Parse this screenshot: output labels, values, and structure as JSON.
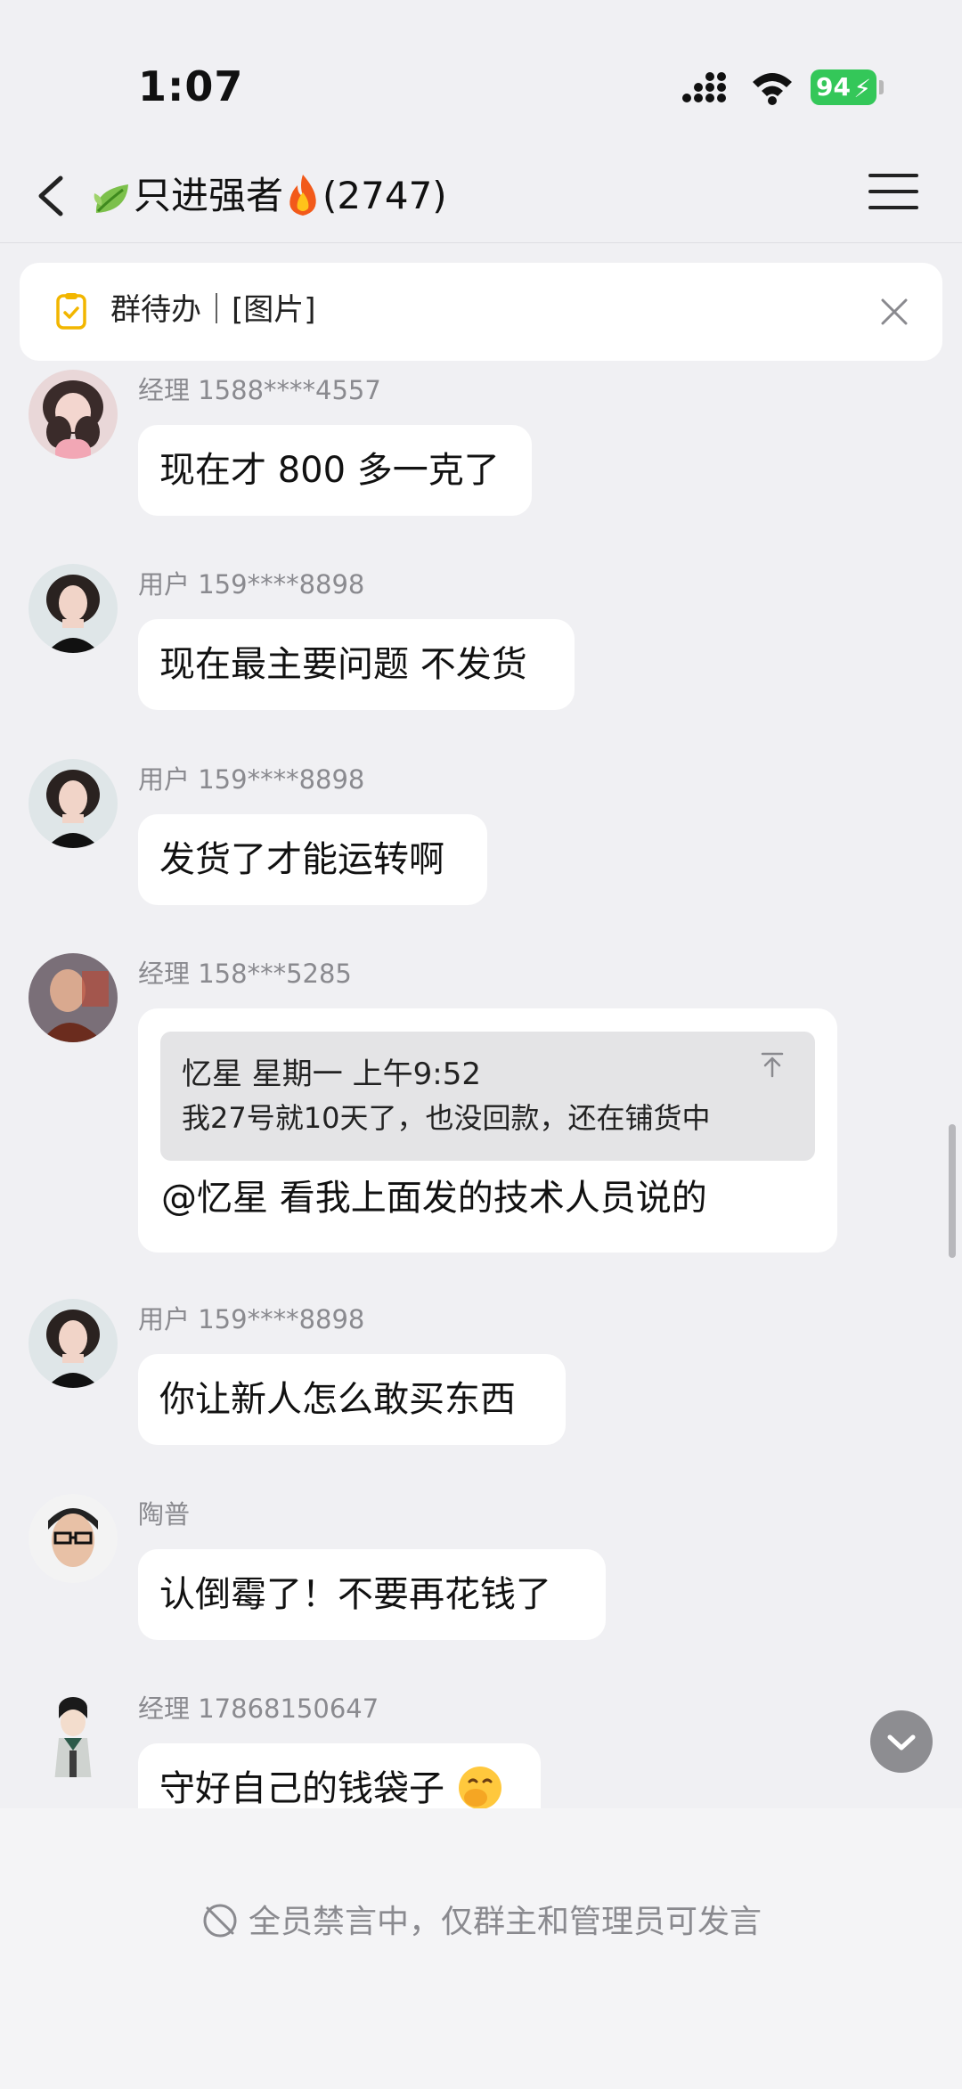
{
  "status_bar": {
    "time": "1:07",
    "battery": "94"
  },
  "header": {
    "group_name": "只进强者",
    "member_count": "(2747)"
  },
  "todo_banner": {
    "text": "群待办｜[图片]"
  },
  "messages": [
    {
      "sender": "经理 1588****4557",
      "text": "现在才 800 多一克了"
    },
    {
      "sender": "用户 159****8898",
      "text": "现在最主要问题 不发货"
    },
    {
      "sender": "用户 159****8898",
      "text": "发货了才能运转啊"
    },
    {
      "sender": "经理 158***5285",
      "quote_author": "忆星  星期一 上午9:52",
      "quote_text": "我27号就10天了，也没回款，还在铺货中",
      "text": "@忆星 看我上面发的技术人员说的"
    },
    {
      "sender": "用户 159****8898",
      "text": "你让新人怎么敢买东西"
    },
    {
      "sender": "陶普",
      "text": "认倒霉了！不要再花钱了"
    },
    {
      "sender": "经理 17868150647",
      "text": "守好自己的钱袋子"
    }
  ],
  "footer": {
    "notice": "全员禁言中，仅群主和管理员可发言"
  }
}
